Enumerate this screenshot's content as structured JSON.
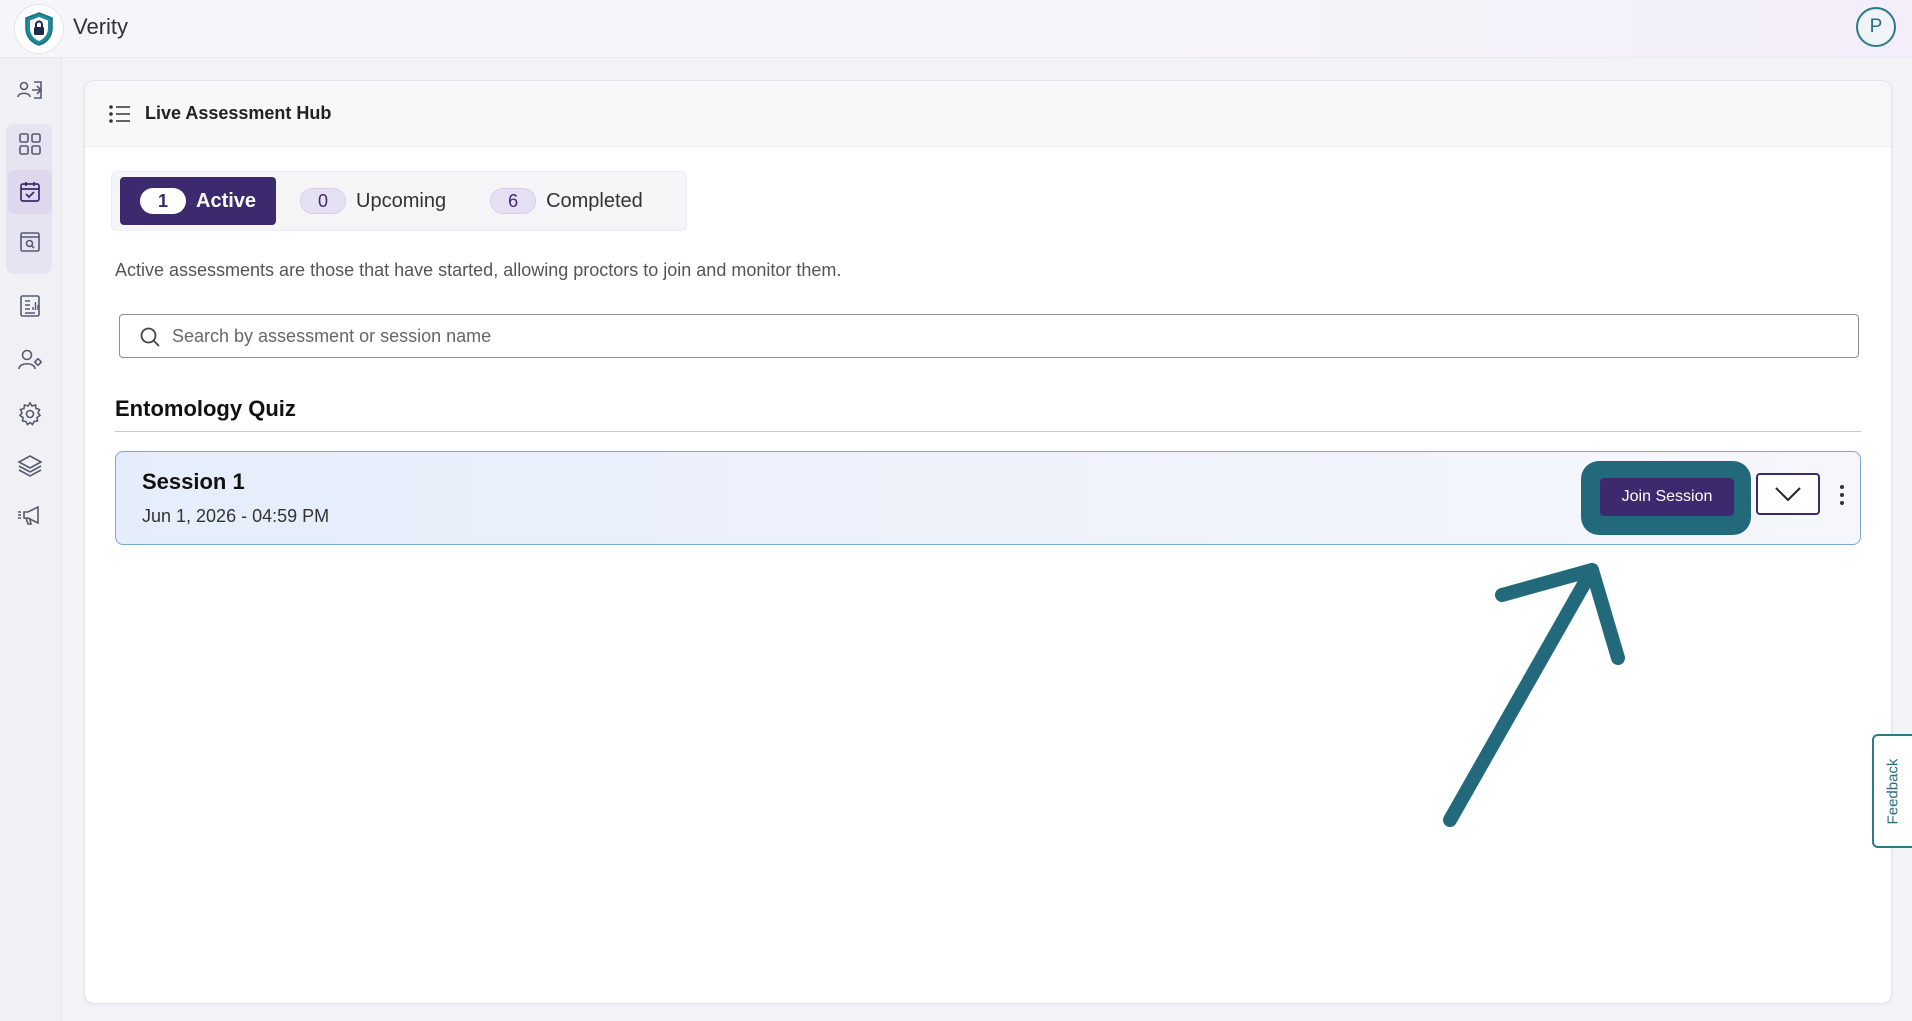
{
  "app": {
    "title": "Verity",
    "user_initial": "P"
  },
  "sidebar": {
    "items": [
      {
        "icon": "user-login-icon"
      },
      {
        "icon": "dashboard-grid-icon"
      },
      {
        "icon": "calendar-check-icon",
        "selected": true
      },
      {
        "icon": "search-window-icon"
      },
      {
        "icon": "report-icon"
      },
      {
        "icon": "user-settings-icon"
      },
      {
        "icon": "gear-icon"
      },
      {
        "icon": "layers-icon"
      },
      {
        "icon": "announcement-icon"
      }
    ]
  },
  "page": {
    "title": "Live Assessment Hub",
    "tabs": [
      {
        "count": "1",
        "label": "Active",
        "active": true
      },
      {
        "count": "0",
        "label": "Upcoming",
        "active": false
      },
      {
        "count": "6",
        "label": "Completed",
        "active": false
      }
    ],
    "description": "Active assessments are those that have started, allowing proctors to join and monitor them.",
    "search": {
      "placeholder": "Search by assessment or session name",
      "value": ""
    },
    "groups": [
      {
        "title": "Entomology Quiz",
        "sessions": [
          {
            "name": "Session 1",
            "datetime": "Jun 1, 2026 - 04:59 PM",
            "join_label": "Join Session"
          }
        ]
      }
    ]
  },
  "feedback": {
    "label": "Feedback"
  },
  "colors": {
    "primary": "#3d2a6e",
    "accent_teal": "#23697c",
    "session_border": "#7fa8d6"
  }
}
